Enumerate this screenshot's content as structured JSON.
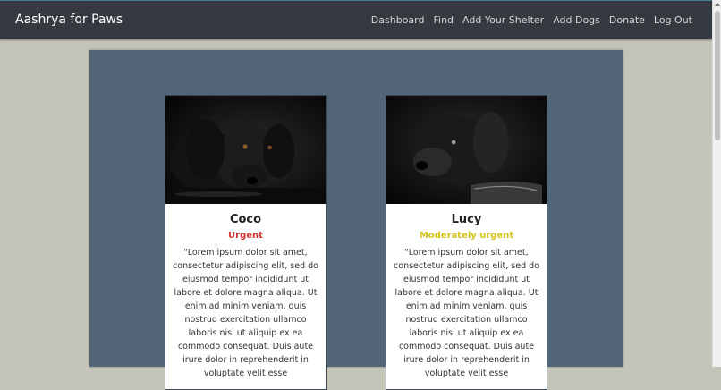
{
  "navbar": {
    "brand": "Aashrya for Paws",
    "links": [
      "Dashboard",
      "Find",
      "Add Your Shelter",
      "Add Dogs",
      "Donate",
      "Log Out"
    ]
  },
  "cards": [
    {
      "name": "Coco",
      "status": "Urgent",
      "status_color": "#d32f2f",
      "description": "\"Lorem ipsum dolor sit amet, consectetur adipiscing elit, sed do eiusmod tempor incididunt ut labore et dolore magna aliqua. Ut enim ad minim veniam, quis nostrud exercitation ullamco laboris nisi ut aliquip ex ea commodo consequat. Duis aute irure dolor in reprehenderit in voluptate velit esse"
    },
    {
      "name": "Lucy",
      "status": "Moderately urgent",
      "status_color": "#d4c417",
      "description": "\"Lorem ipsum dolor sit amet, consectetur adipiscing elit, sed do eiusmod tempor incididunt ut labore et dolore magna aliqua. Ut enim ad minim veniam, quis nostrud exercitation ullamco laboris nisi ut aliquip ex ea commodo consequat. Duis aute irure dolor in reprehenderit in voluptate velit esse"
    }
  ]
}
